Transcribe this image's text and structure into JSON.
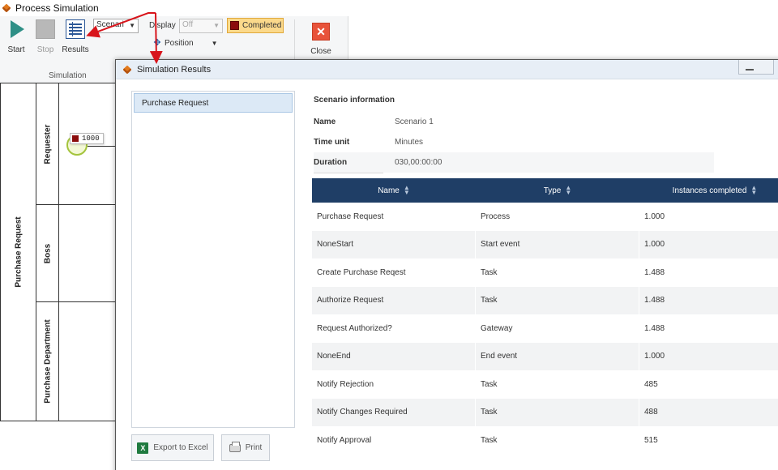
{
  "window": {
    "title": "Process Simulation"
  },
  "ribbon": {
    "start_label": "Start",
    "stop_label": "Stop",
    "results_label": "Results",
    "scenario_select_value": "Scenari",
    "display_label": "Display",
    "display_select_value": "Off",
    "completed_label": "Completed",
    "completed_color": "#8b0c0c",
    "position_label": "Position",
    "group_label": "Simulation",
    "close_label": "Close"
  },
  "pool": {
    "name": "Purchase Request",
    "lanes": [
      "Requester",
      "Boss",
      "Purchase Department"
    ],
    "token_value": "1000"
  },
  "dialog": {
    "title": "Simulation Results",
    "scenarios": [
      "Purchase Request"
    ],
    "export_label": "Export to Excel",
    "print_label": "Print",
    "info": {
      "title": "Scenario information",
      "rows": [
        {
          "label": "Name",
          "value": "Scenario 1"
        },
        {
          "label": "Time unit",
          "value": "Minutes"
        },
        {
          "label": "Duration",
          "value": "030,00:00:00"
        }
      ]
    },
    "table": {
      "headers": [
        "Name",
        "Type",
        "Instances completed"
      ],
      "rows": [
        [
          "Purchase Request",
          "Process",
          "1.000"
        ],
        [
          "NoneStart",
          "Start event",
          "1.000"
        ],
        [
          "Create Purchase Reqest",
          "Task",
          "1.488"
        ],
        [
          "Authorize Request",
          "Task",
          "1.488"
        ],
        [
          "Request Authorized?",
          "Gateway",
          "1.488"
        ],
        [
          "NoneEnd",
          "End event",
          "1.000"
        ],
        [
          "Notify Rejection",
          "Task",
          "485"
        ],
        [
          "Notify Changes Required",
          "Task",
          "488"
        ],
        [
          "Notify Approval",
          "Task",
          "515"
        ]
      ]
    }
  },
  "colors": {
    "header_bg": "#1f3e66",
    "accent_annotation": "#d8141b",
    "completed_bg": "#fbd98b"
  }
}
